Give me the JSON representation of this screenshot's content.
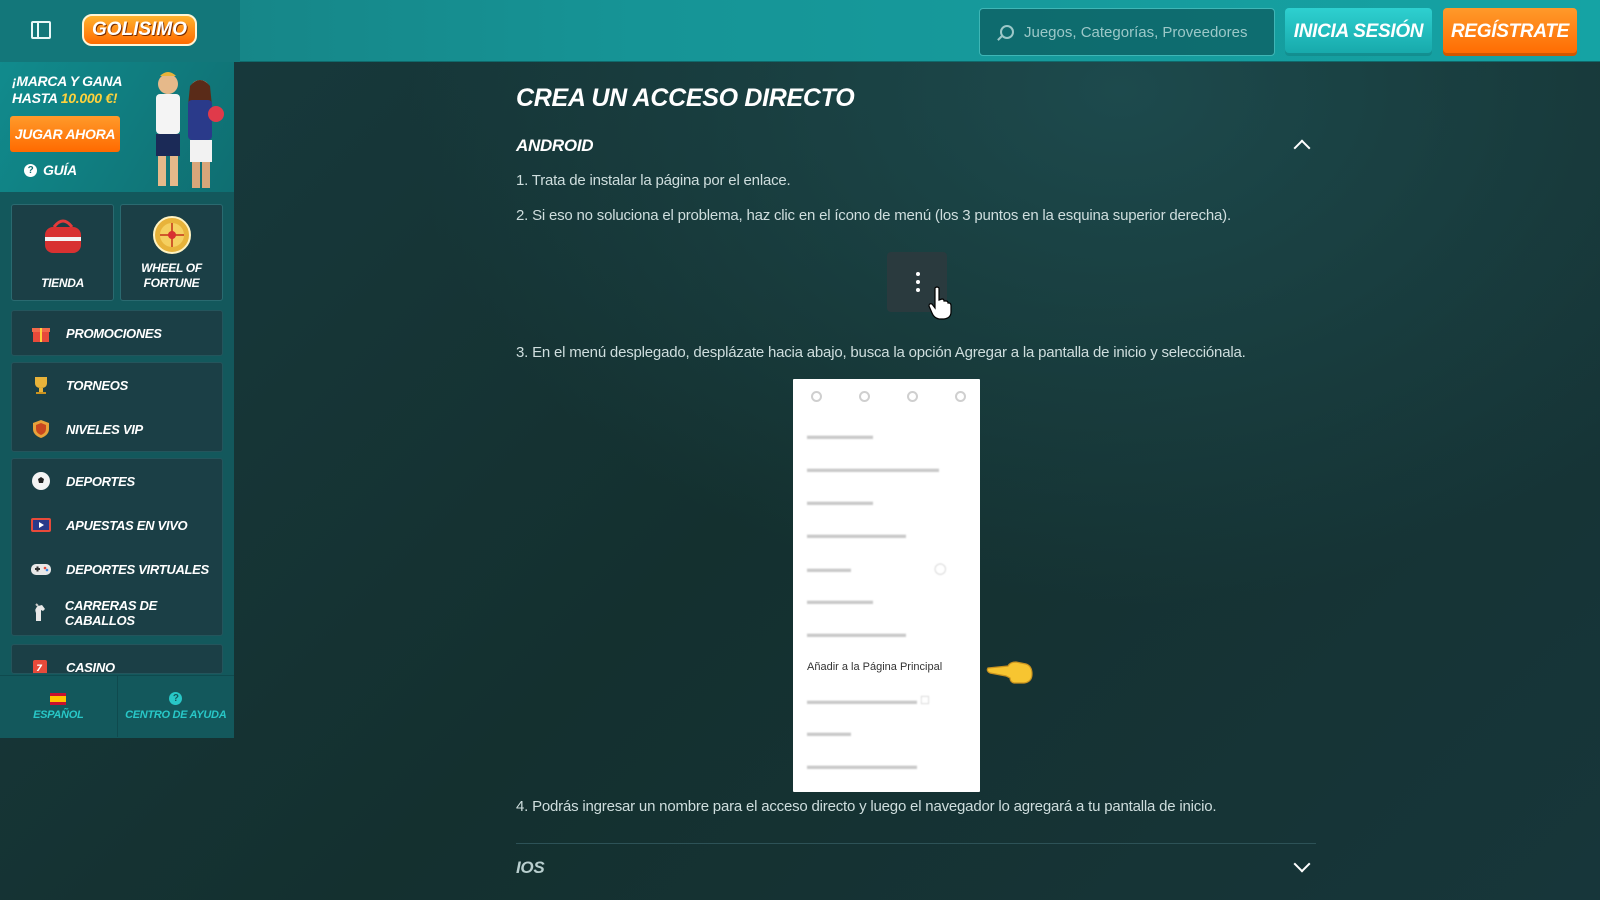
{
  "header": {
    "logo_text": "GOLISIMO",
    "search_placeholder": "Juegos, Categorías, Proveedores",
    "login_label": "INICIA SESIÓN",
    "register_label": "REGÍSTRATE"
  },
  "sidebar": {
    "promo": {
      "title_line1": "¡MARCA Y GANA",
      "title_line2_prefix": "HASTA ",
      "amount": "10.000 €!",
      "play_label": "JUGAR AHORA",
      "guide_label": "GUÍA"
    },
    "tiles": [
      {
        "label": "TIENDA"
      },
      {
        "label": "WHEEL OF FORTUNE"
      }
    ],
    "groups": [
      {
        "items": [
          {
            "label": "PROMOCIONES",
            "icon": "gift-icon"
          }
        ]
      },
      {
        "items": [
          {
            "label": "TORNEOS",
            "icon": "trophy-icon"
          },
          {
            "label": "NIVELES VIP",
            "icon": "vip-shield-icon"
          }
        ]
      },
      {
        "items": [
          {
            "label": "DEPORTES",
            "icon": "soccer-ball-icon"
          },
          {
            "label": "APUESTAS EN VIVO",
            "icon": "live-tv-icon"
          },
          {
            "label": "DEPORTES VIRTUALES",
            "icon": "gamepad-icon"
          },
          {
            "label": "CARRERAS DE CABALLOS",
            "icon": "horse-icon"
          }
        ]
      },
      {
        "items": [
          {
            "label": "CASINO",
            "icon": "slot-machine-icon"
          }
        ]
      }
    ],
    "bottom": {
      "language_label": "ESPAÑOL",
      "help_label": "CENTRO DE AYUDA"
    }
  },
  "main": {
    "title": "CREA UN ACCESO DIRECTO",
    "android": {
      "title": "ANDROID",
      "steps": [
        "1. Trata de instalar la página por el enlace.",
        "2. Si eso no soluciona el problema, haz clic en el ícono de menú (los 3 puntos en la esquina superior derecha).",
        "3. En el menú desplegado, desplázate hacia abajo, busca la opción Agregar a la pantalla de inicio y selecciónala.",
        "4. Podrás ingresar un nombre para el acceso directo y luego el navegador lo agregará a tu pantalla de inicio."
      ],
      "menu_highlight": "Añadir a la Página Principal"
    },
    "ios": {
      "title": "IOS"
    }
  },
  "colors": {
    "accent_teal": "#16a7a9",
    "accent_orange": "#ff6a00",
    "background": "#17363a"
  }
}
